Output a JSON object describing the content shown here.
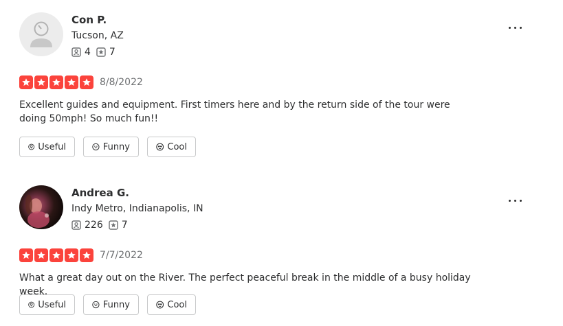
{
  "reviews": [
    {
      "user": {
        "name": "Con P.",
        "location": "Tucson, AZ",
        "reviews_count": "4",
        "photos_count": "7"
      },
      "rating": 5,
      "date": "8/8/2022",
      "text": "Excellent guides and equipment. First timers here and by the return side of the tour were doing 50mph!  So much fun!!",
      "reactions": {
        "useful": "Useful",
        "funny": "Funny",
        "cool": "Cool"
      }
    },
    {
      "user": {
        "name": "Andrea G.",
        "location": "Indy Metro, Indianapolis, IN",
        "reviews_count": "226",
        "photos_count": "7"
      },
      "rating": 5,
      "date": "7/7/2022",
      "text": "What a great day out on the River. The perfect peaceful break in the middle of a busy holiday week.",
      "reactions": {
        "useful": "Useful",
        "funny": "Funny",
        "cool": "Cool"
      }
    }
  ],
  "colors": {
    "star": "#fb433c",
    "text": "#2d2e2f",
    "muted": "#6e7072"
  },
  "icons": [
    "default-avatar-icon",
    "review-count-icon",
    "photo-count-icon",
    "star-icon",
    "more-options-icon",
    "lightbulb-icon",
    "smile-icon",
    "sunglasses-icon"
  ]
}
